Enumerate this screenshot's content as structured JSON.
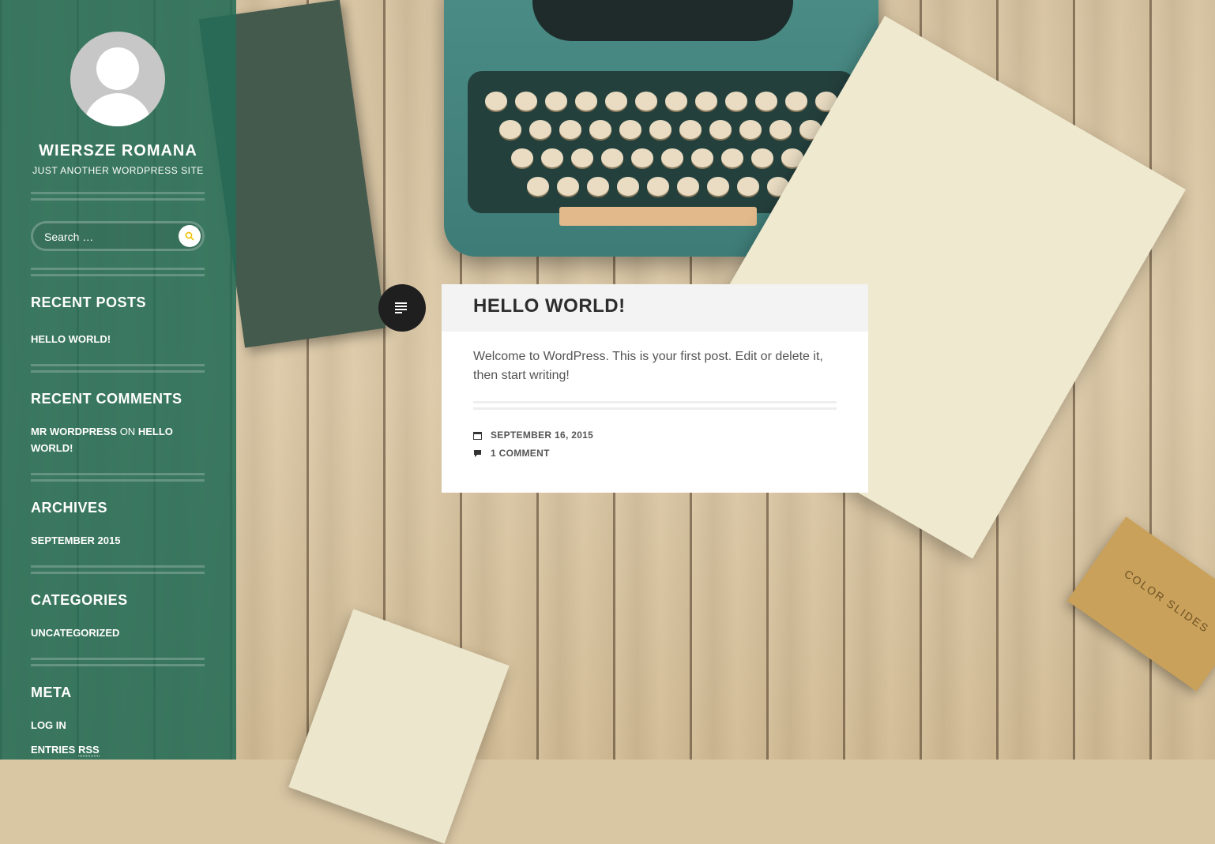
{
  "site": {
    "title": "WIERSZE ROMANA",
    "description": "JUST ANOTHER WORDPRESS SITE"
  },
  "search": {
    "placeholder": "Search …"
  },
  "widgets": {
    "recent_posts": {
      "title": "RECENT POSTS",
      "items": [
        "HELLO WORLD!"
      ]
    },
    "recent_comments": {
      "title": "RECENT COMMENTS",
      "author": "MR WORDPRESS",
      "on": "ON",
      "post": "HELLO WORLD!"
    },
    "archives": {
      "title": "ARCHIVES",
      "items": [
        "SEPTEMBER 2015"
      ]
    },
    "categories": {
      "title": "CATEGORIES",
      "items": [
        "UNCATEGORIZED"
      ]
    },
    "meta": {
      "title": "META",
      "log_in": "LOG IN",
      "entries": "ENTRIES",
      "rss": "RSS"
    }
  },
  "post": {
    "title": "HELLO WORLD!",
    "content": "Welcome to WordPress. This is your first post. Edit or delete it, then start writing!",
    "date": "SEPTEMBER 16, 2015",
    "comments": "1 COMMENT"
  },
  "background": {
    "slides_box_label": "COLOR SLIDES"
  },
  "colors": {
    "sidebar": "#246c56",
    "post_header": "#f3f3f3",
    "format_icon": "#1f1f1f",
    "search_button_icon": "#f0c419"
  }
}
